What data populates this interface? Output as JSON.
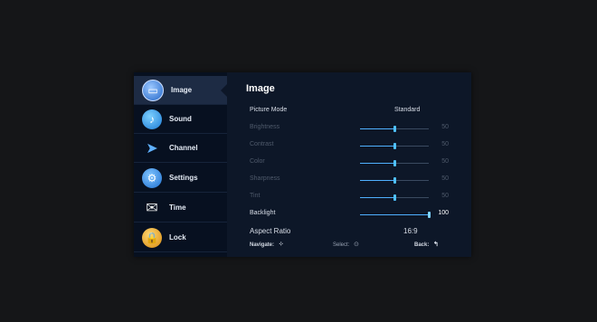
{
  "sidebar": {
    "items": [
      {
        "label": "Image",
        "icon": "image-icon",
        "glyph": "▭",
        "active": true
      },
      {
        "label": "Sound",
        "icon": "sound-icon",
        "glyph": "♪"
      },
      {
        "label": "Channel",
        "icon": "satellite-dish-icon",
        "glyph": "➤"
      },
      {
        "label": "Settings",
        "icon": "settings-icon",
        "glyph": "⚙"
      },
      {
        "label": "Time",
        "icon": "clock-icon",
        "glyph": "✉"
      },
      {
        "label": "Lock",
        "icon": "lock-icon",
        "glyph": "🔒"
      }
    ]
  },
  "panel": {
    "title": "Image",
    "rows": [
      {
        "label": "Picture Mode",
        "value": "Standard",
        "type": "select",
        "enabled": true
      },
      {
        "label": "Brightness",
        "value": "50",
        "level": 0.5,
        "type": "slider",
        "enabled": false
      },
      {
        "label": "Contrast",
        "value": "50",
        "level": 0.5,
        "type": "slider",
        "enabled": false
      },
      {
        "label": "Color",
        "value": "50",
        "level": 0.5,
        "type": "slider",
        "enabled": false
      },
      {
        "label": "Sharpness",
        "value": "50",
        "level": 0.5,
        "type": "slider",
        "enabled": false
      },
      {
        "label": "Tint",
        "value": "50",
        "level": 0.5,
        "type": "slider",
        "enabled": false
      },
      {
        "label": "Backlight",
        "value": "100",
        "level": 1.0,
        "type": "slider",
        "enabled": true
      },
      {
        "label": "Aspect Ratio",
        "value": "16:9",
        "type": "select",
        "enabled": true
      }
    ]
  },
  "footer": {
    "navigate_label": "Navigate:",
    "navigate_icon": "⁘",
    "select_label": "Select:",
    "select_icon": "⊙",
    "back_label": "Back:",
    "back_icon": "↰"
  },
  "colors": {
    "accent": "#4fc1ff",
    "panel_bg": "#0d1728",
    "sidebar_bg": "#071020"
  }
}
